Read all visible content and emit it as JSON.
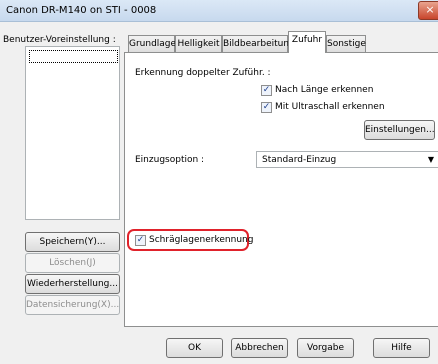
{
  "window": {
    "title": "Canon DR-M140 on STI - 0008",
    "close_glyph": "×"
  },
  "left": {
    "label": "Benutzer-Voreinstellung :",
    "buttons": {
      "save": "Speichern(Y)...",
      "delete": "Löschen(J)",
      "restore": "Wiederherstellung...",
      "backup": "Datensicherung(X)..."
    }
  },
  "tabs": [
    {
      "label": "Grundlage"
    },
    {
      "label": "Helligkeit"
    },
    {
      "label": "Bildbearbeitung"
    },
    {
      "label": "Zufuhr"
    },
    {
      "label": "Sonstige"
    }
  ],
  "zufuhr": {
    "double_feed_label": "Erkennung doppelter Zuführ. :",
    "by_length_label": "Nach Länge erkennen",
    "by_length_checked": true,
    "ultrasonic_label": "Mit Ultraschall erkennen",
    "ultrasonic_checked": true,
    "settings_button": "Einstellungen...",
    "feed_option_label": "Einzugsoption :",
    "feed_option_value": "Standard-Einzug",
    "skew_label": "Schräglagenerkennung",
    "skew_checked": true
  },
  "footer": {
    "ok": "OK",
    "cancel": "Abbrechen",
    "default": "Vorgabe",
    "help": "Hilfe"
  },
  "colors": {
    "highlight": "#e0222b",
    "check": "#1d3e8c"
  },
  "icons": {
    "check": "✓",
    "dropdown": "▼"
  }
}
